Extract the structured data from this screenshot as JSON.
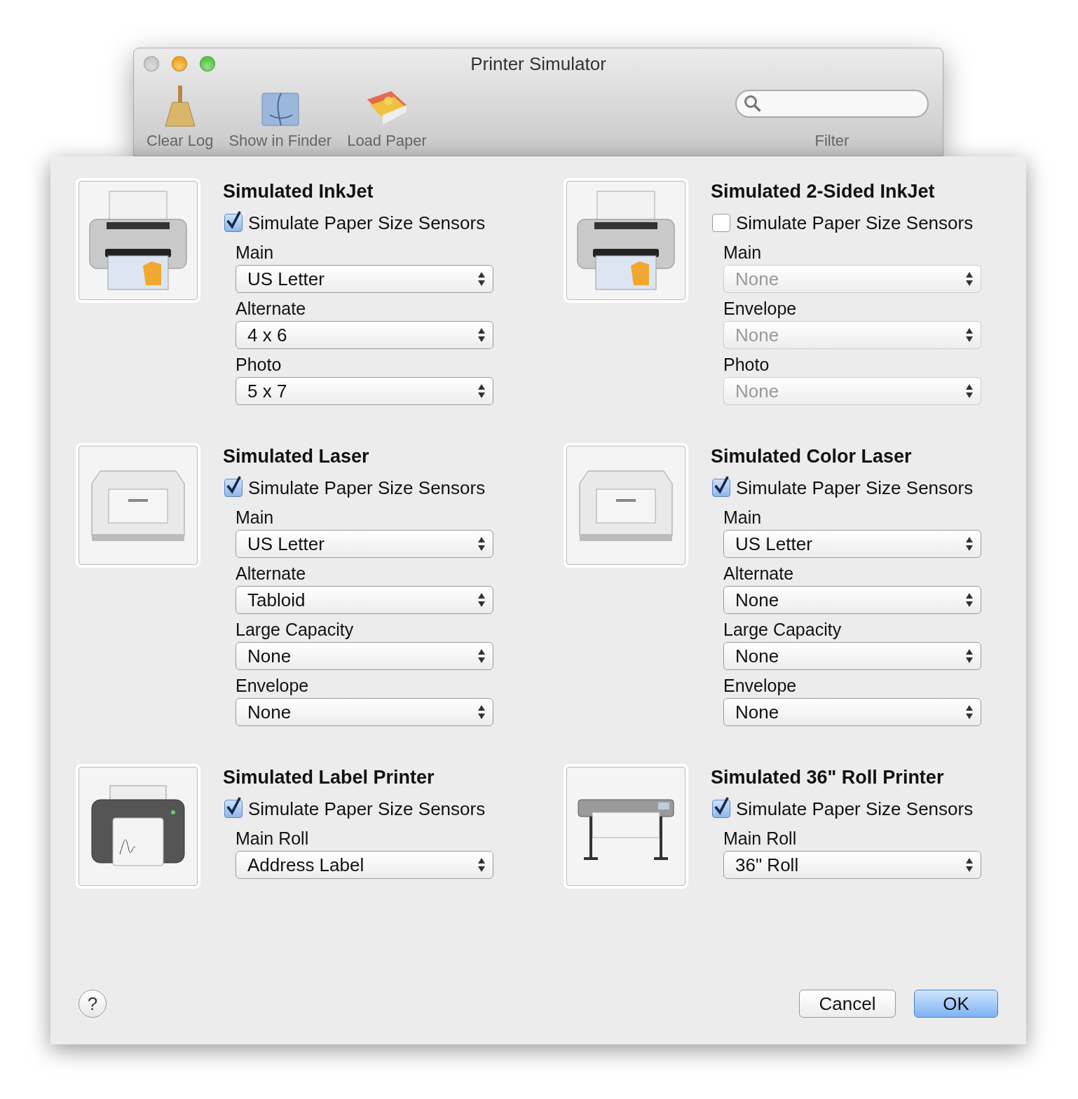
{
  "window": {
    "title": "Printer Simulator"
  },
  "toolbar": {
    "items": [
      {
        "label": "Clear Log",
        "kind": "broom"
      },
      {
        "label": "Show in Finder",
        "kind": "finder"
      },
      {
        "label": "Load Paper",
        "kind": "paper"
      }
    ],
    "search": {
      "label": "Filter"
    }
  },
  "printers": [
    {
      "name": "Simulated InkJet",
      "kind": "inkjet",
      "sensors": {
        "label": "Simulate Paper Size Sensors",
        "checked": true
      },
      "trays": [
        {
          "label": "Main",
          "value": "US Letter"
        },
        {
          "label": "Alternate",
          "value": "4 x 6"
        },
        {
          "label": "Photo",
          "value": "5 x 7"
        }
      ]
    },
    {
      "name": "Simulated 2-Sided InkJet",
      "kind": "inkjet",
      "sensors": {
        "label": "Simulate Paper Size Sensors",
        "checked": false
      },
      "trays": [
        {
          "label": "Main",
          "value": "None"
        },
        {
          "label": "Envelope",
          "value": "None"
        },
        {
          "label": "Photo",
          "value": "None"
        }
      ]
    },
    {
      "name": "Simulated Laser",
      "kind": "laser",
      "sensors": {
        "label": "Simulate Paper Size Sensors",
        "checked": true
      },
      "trays": [
        {
          "label": "Main",
          "value": "US Letter"
        },
        {
          "label": "Alternate",
          "value": "Tabloid"
        },
        {
          "label": "Large Capacity",
          "value": "None"
        },
        {
          "label": "Envelope",
          "value": "None"
        }
      ]
    },
    {
      "name": "Simulated Color Laser",
      "kind": "laser",
      "sensors": {
        "label": "Simulate Paper Size Sensors",
        "checked": true
      },
      "trays": [
        {
          "label": "Main",
          "value": "US Letter"
        },
        {
          "label": "Alternate",
          "value": "None"
        },
        {
          "label": "Large Capacity",
          "value": "None"
        },
        {
          "label": "Envelope",
          "value": "None"
        }
      ]
    },
    {
      "name": "Simulated Label Printer",
      "kind": "label",
      "sensors": {
        "label": "Simulate Paper Size Sensors",
        "checked": true
      },
      "trays": [
        {
          "label": "Main Roll",
          "value": "Address Label"
        }
      ]
    },
    {
      "name": "Simulated 36\" Roll Printer",
      "kind": "roll",
      "sensors": {
        "label": "Simulate Paper Size Sensors",
        "checked": true
      },
      "trays": [
        {
          "label": "Main Roll",
          "value": "36\" Roll"
        }
      ]
    }
  ],
  "footer": {
    "help": "?",
    "buttons": [
      {
        "label": "Cancel",
        "default": false
      },
      {
        "label": "OK",
        "default": true
      }
    ]
  }
}
